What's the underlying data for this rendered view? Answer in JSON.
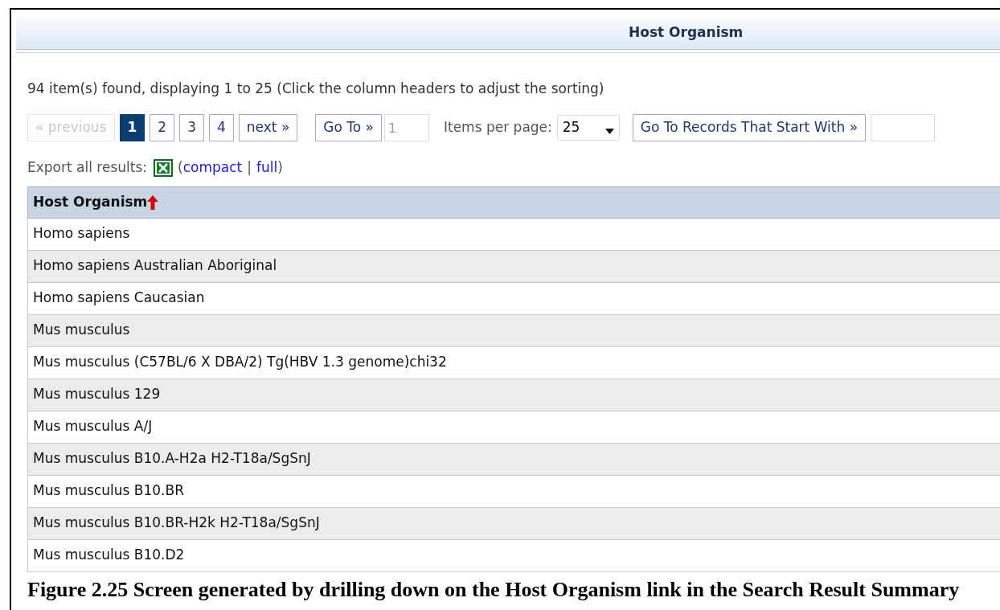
{
  "panel": {
    "title": "Host Organism"
  },
  "summary": "94 item(s) found, displaying 1 to 25 (Click the column headers to adjust the sorting)",
  "pager": [
    {
      "label": "« previous",
      "disabled": true,
      "selected": false
    },
    {
      "label": "1",
      "selected": true,
      "disabled": false
    },
    {
      "label": "2",
      "selected": false,
      "disabled": false
    },
    {
      "label": "3",
      "selected": false,
      "disabled": false
    },
    {
      "label": "4",
      "selected": false,
      "disabled": false
    },
    {
      "label": "next »",
      "selected": false,
      "disabled": false
    }
  ],
  "goto": {
    "button": "Go To »",
    "value": "1"
  },
  "per_page": {
    "label": "Items per page:",
    "value": "25"
  },
  "start_with": {
    "button": "Go To Records That Start With »"
  },
  "export": {
    "label": "Export all results:",
    "open": "(",
    "links": [
      "compact",
      "full"
    ],
    "separator": "|",
    "close": ")"
  },
  "table": {
    "columns": [
      {
        "label": "Host Organism",
        "sorted": true
      }
    ],
    "rows": [
      "Homo sapiens",
      "Homo sapiens Australian Aboriginal",
      "Homo sapiens Caucasian",
      "Mus musculus",
      "Mus musculus (C57BL/6 X DBA/2) Tg(HBV 1.3 genome)chi32",
      "Mus musculus 129",
      "Mus musculus A/J",
      "Mus musculus B10.A-H2a H2-T18a/SgSnJ",
      "Mus musculus B10.BR",
      "Mus musculus B10.BR-H2k H2-T18a/SgSnJ",
      "Mus musculus B10.D2"
    ]
  },
  "caption": "Figure 2.25  Screen generated by drilling down on the Host Organism link in the Search Result Summary"
}
